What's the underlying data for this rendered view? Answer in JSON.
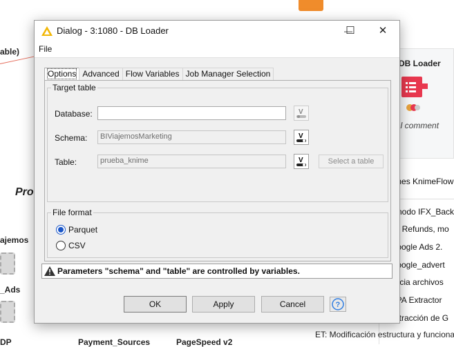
{
  "background": {
    "left_texts": [
      "able)",
      "Proc",
      "ajemos",
      "_Ads",
      "Payment_Sources",
      "PageSpeed v2"
    ],
    "node_label": "DB Loader",
    "node_comment": "al comment",
    "list_items": [
      "iones KnimeFlow",
      "o nodo IFX_Back",
      "ed Refunds, mo",
      "Google Ads 2.",
      "Google_advert",
      "encia archivos",
      "RPA Extractor",
      "extracción de G",
      "ET: Modificación estructura y funciona"
    ]
  },
  "dialog": {
    "title": "Dialog - 3:1080 - DB Loader",
    "window_buttons": {
      "minimize": "—",
      "maximize": "☐",
      "close": "✕"
    },
    "menu": {
      "file": "File"
    },
    "tabs": [
      "Options",
      "Advanced",
      "Flow Variables",
      "Job Manager Selection"
    ],
    "active_tab": "Options",
    "target_table": {
      "legend": "Target table",
      "database_label": "Database:",
      "database_value": "",
      "schema_label": "Schema:",
      "schema_value": "BIViajemosMarketing",
      "table_label": "Table:",
      "table_value": "prueba_knime",
      "select_table_button": "Select a table"
    },
    "file_format": {
      "legend": "File format",
      "options": [
        "Parquet",
        "CSV"
      ],
      "selected": "Parquet"
    },
    "warning": "Parameters \"schema\" and \"table\" are controlled by variables.",
    "buttons": {
      "ok": "OK",
      "apply": "Apply",
      "cancel": "Cancel"
    },
    "colors": {
      "accent": "#1a56c8",
      "knime_node": "#e8384f",
      "warning_icon": "#333333",
      "title_icon": "#f2b705"
    }
  }
}
